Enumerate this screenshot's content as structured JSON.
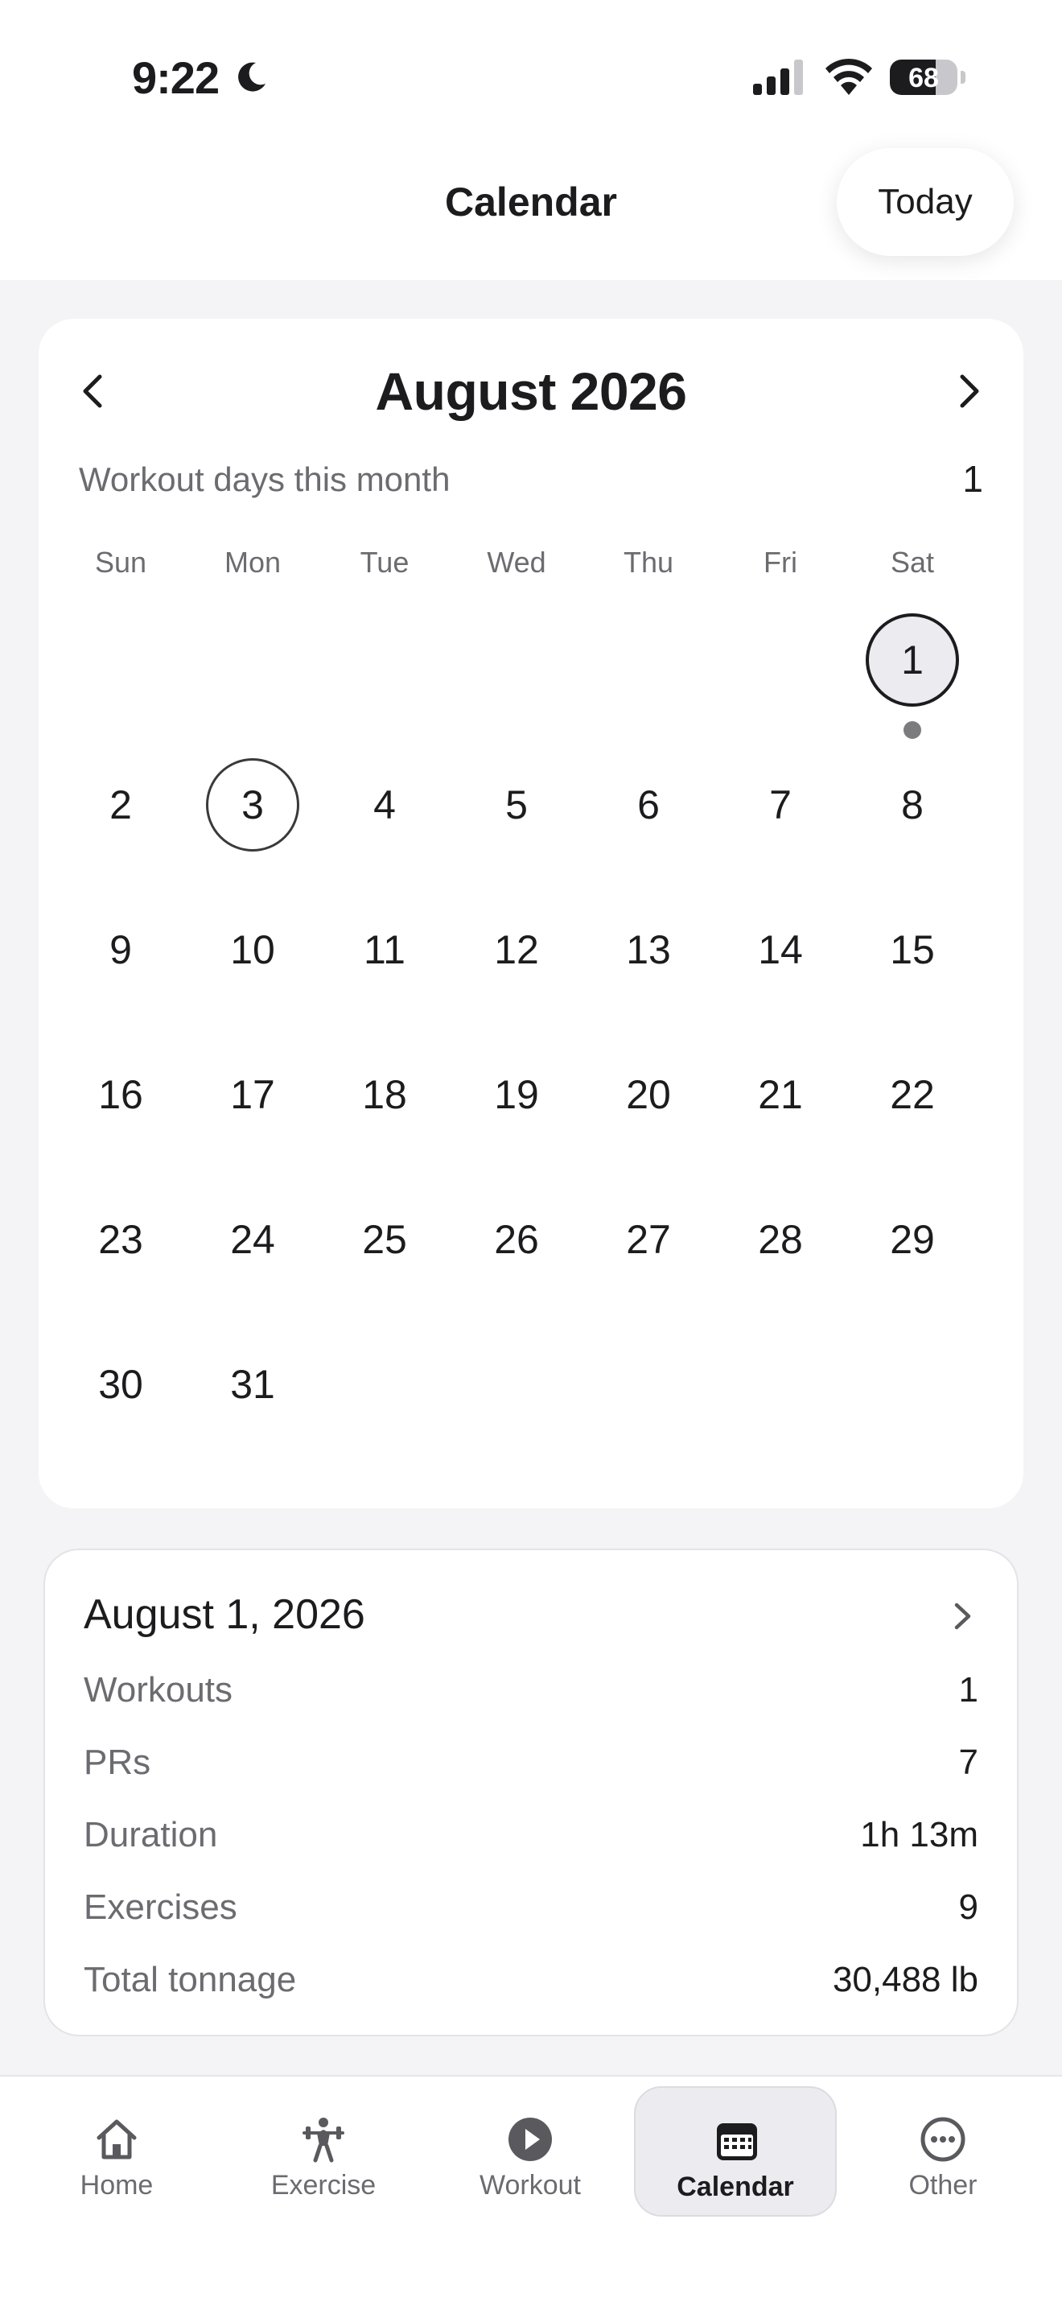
{
  "status_bar": {
    "time": "9:22",
    "battery": "68",
    "battery_level": 0.68
  },
  "header": {
    "title": "Calendar",
    "today_label": "Today"
  },
  "calendar": {
    "month_title": "August 2026",
    "workout_days_label": "Workout days this month",
    "workout_days_value": "1",
    "weekdays": [
      "Sun",
      "Mon",
      "Tue",
      "Wed",
      "Thu",
      "Fri",
      "Sat"
    ],
    "first_weekday_index": 6,
    "days_in_month": 31,
    "selected_day": 1,
    "today_day": 3,
    "workout_days": [
      1
    ]
  },
  "summary": {
    "date": "August 1, 2026",
    "rows": [
      {
        "label": "Workouts",
        "value": "1"
      },
      {
        "label": "PRs",
        "value": "7"
      },
      {
        "label": "Duration",
        "value": "1h 13m"
      },
      {
        "label": "Exercises",
        "value": "9"
      },
      {
        "label": "Total tonnage",
        "value": "30,488 lb"
      }
    ]
  },
  "tabs": [
    {
      "label": "Home",
      "icon": "home-icon"
    },
    {
      "label": "Exercise",
      "icon": "weightlifter-icon"
    },
    {
      "label": "Workout",
      "icon": "play-circle-icon"
    },
    {
      "label": "Calendar",
      "icon": "calendar-icon",
      "active": true
    },
    {
      "label": "Other",
      "icon": "more-circle-icon"
    }
  ],
  "colors": {
    "background": "#f4f4f6",
    "text": "#1c1c1e",
    "secondary_text": "#6b6b70",
    "dot": "#7c7c80"
  }
}
